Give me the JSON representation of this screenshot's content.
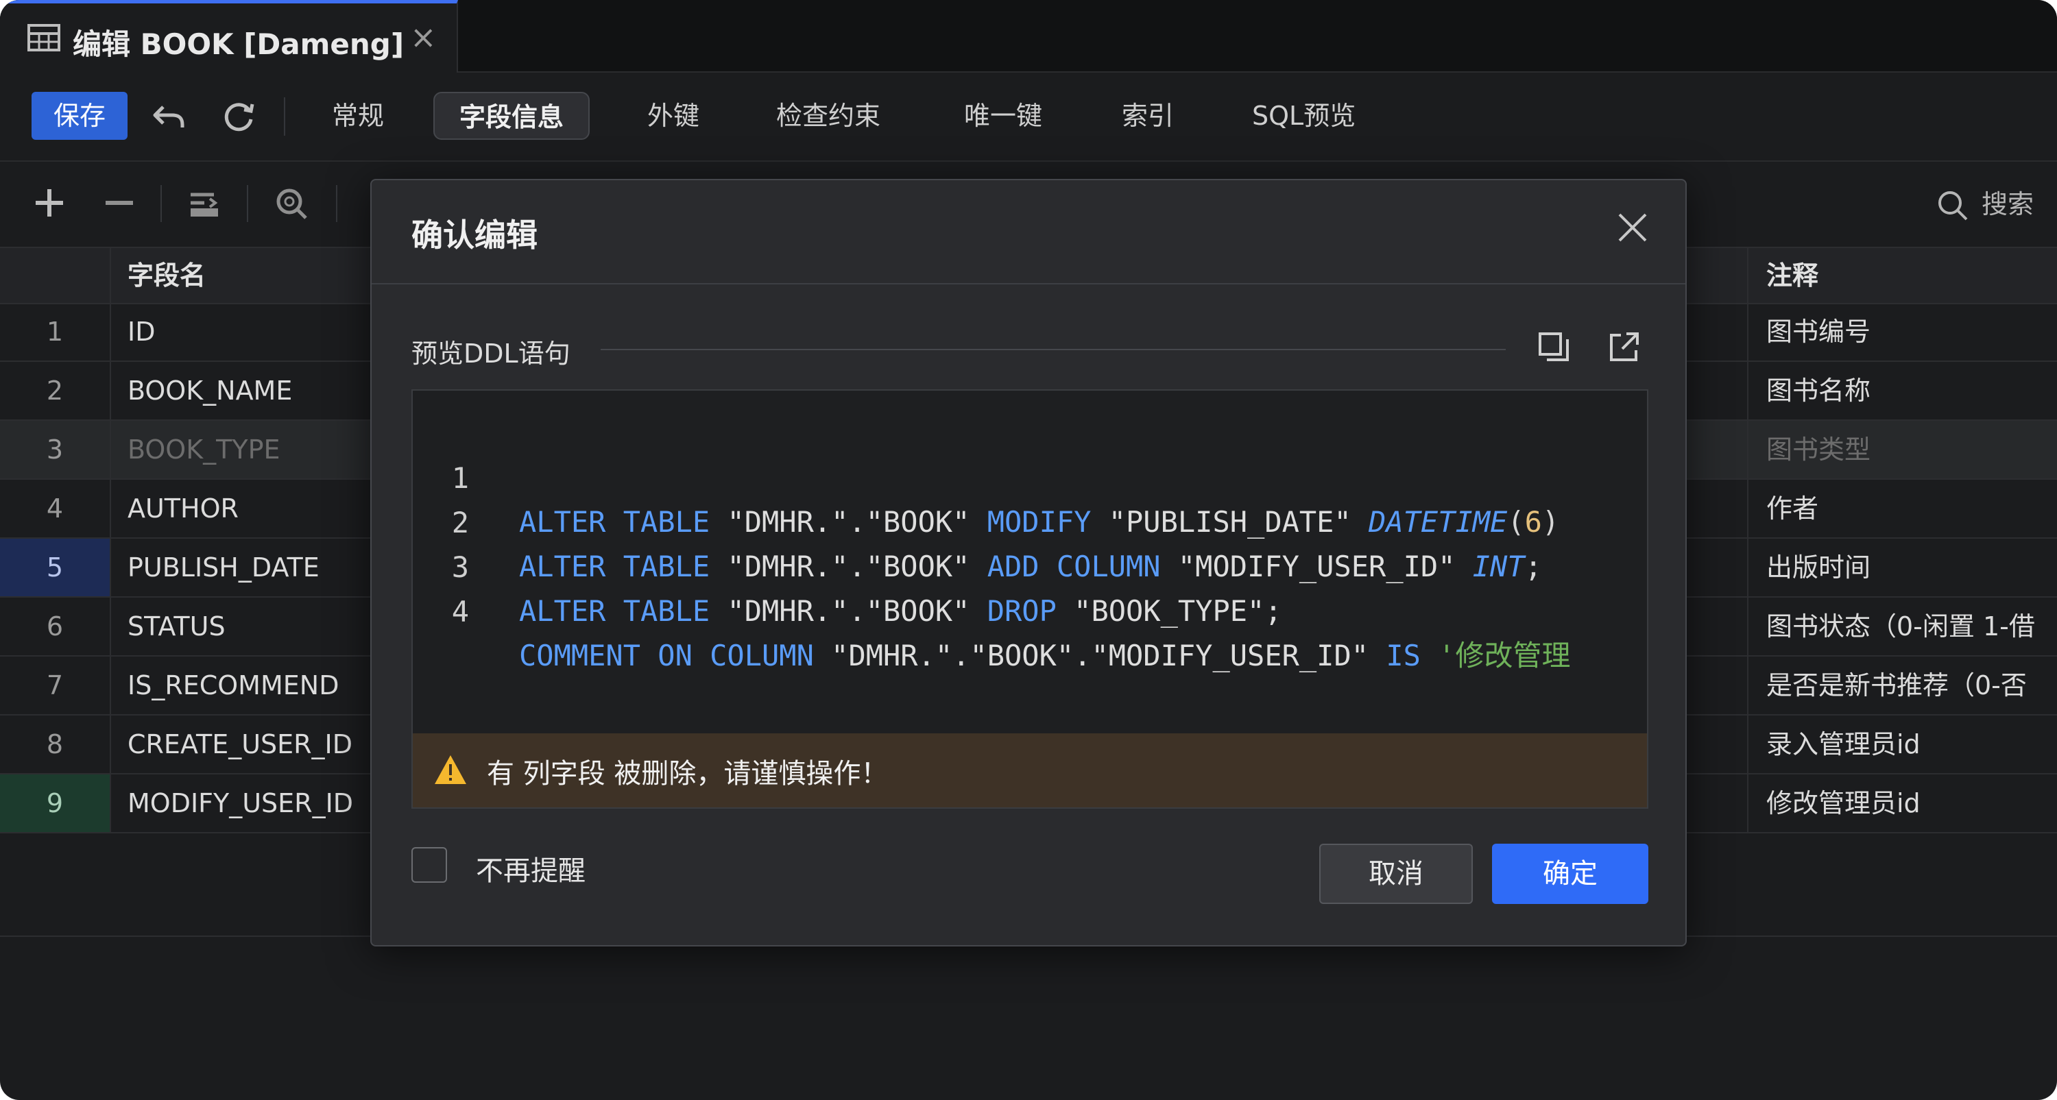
{
  "tab": {
    "title": "编辑 BOOK [Dameng]",
    "icon": "table-icon",
    "close": "×"
  },
  "toolbar": {
    "save_label": "保存",
    "tabs": [
      "常规",
      "字段信息",
      "外键",
      "检查约束",
      "唯一键",
      "索引",
      "SQL预览"
    ],
    "active_tab": "字段信息"
  },
  "field_toolbar": {
    "search_label": "搜索"
  },
  "grid": {
    "headers": {
      "name": "字段名",
      "comment": "注释"
    },
    "rows": [
      {
        "num": "1",
        "name": "ID",
        "comment": "图书编号"
      },
      {
        "num": "2",
        "name": "BOOK_NAME",
        "comment": "图书名称"
      },
      {
        "num": "3",
        "name": "BOOK_TYPE",
        "comment": "图书类型"
      },
      {
        "num": "4",
        "name": "AUTHOR",
        "comment": "作者"
      },
      {
        "num": "5",
        "name": "PUBLISH_DATE",
        "comment": "出版时间"
      },
      {
        "num": "6",
        "name": "STATUS",
        "comment": "图书状态（0-闲置 1-借"
      },
      {
        "num": "7",
        "name": "IS_RECOMMEND",
        "comment": "是否是新书推荐（0-否"
      },
      {
        "num": "8",
        "name": "CREATE_USER_ID",
        "comment": "录入管理员id"
      },
      {
        "num": "9",
        "name": "MODIFY_USER_ID",
        "comment": "修改管理员id"
      }
    ]
  },
  "dialog": {
    "title": "确认编辑",
    "preview_label": "预览DDL语句",
    "code": {
      "line_numbers": [
        "1",
        "2",
        "3",
        "4"
      ],
      "l1": [
        "ALTER TABLE",
        " \"DMHR.\".\"BOOK\" ",
        "MODIFY",
        " \"PUBLISH_DATE\" ",
        "DATETIME",
        "(",
        "6",
        ")"
      ],
      "l2": [
        "ALTER TABLE",
        " \"DMHR.\".\"BOOK\" ",
        "ADD COLUMN",
        " \"MODIFY_USER_ID\" ",
        "INT",
        ";"
      ],
      "l3": [
        "ALTER TABLE",
        " \"DMHR.\".\"BOOK\" ",
        "DROP",
        " \"BOOK_TYPE\";"
      ],
      "l4": [
        "COMMENT ON COLUMN",
        " \"DMHR.\".\"BOOK\".\"MODIFY_USER_ID\" ",
        "IS",
        " '修改管理"
      ]
    },
    "warning": "有 列字段 被删除，请谨慎操作！",
    "dont_remind": "不再提醒",
    "cancel": "取消",
    "confirm": "确定"
  },
  "colors": {
    "accent": "#2f6bf7",
    "warning_bg": "#3e3226",
    "warning_icon": "#f5b82e"
  }
}
